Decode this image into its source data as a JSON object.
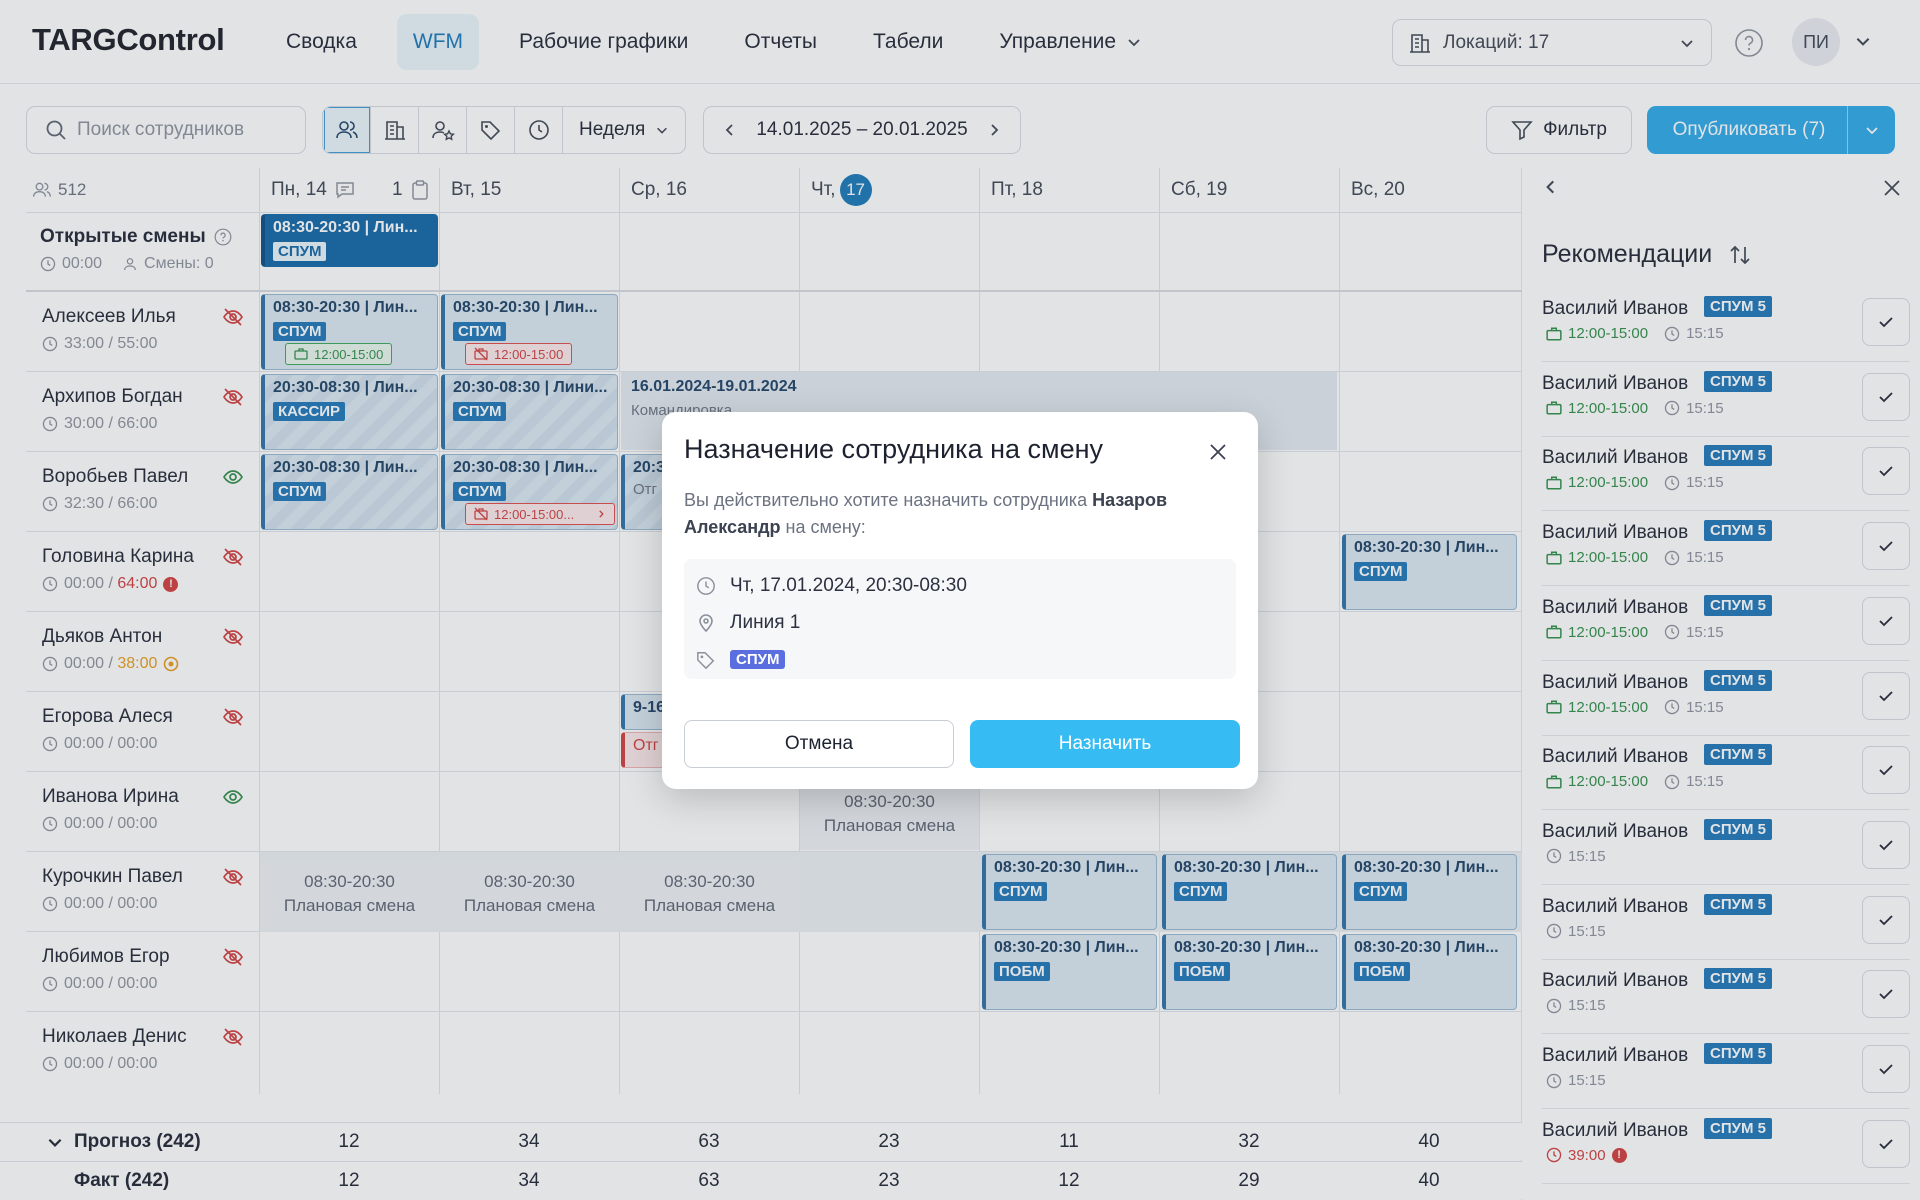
{
  "header": {
    "logo": "TARGControl",
    "nav": [
      {
        "label": "Сводка"
      },
      {
        "label": "WFM"
      },
      {
        "label": "Рабочие графики"
      },
      {
        "label": "Отчеты"
      },
      {
        "label": "Табели"
      },
      {
        "label": "Управление"
      }
    ],
    "locations": "Локаций: 17",
    "avatar": "ПИ"
  },
  "toolbar": {
    "search_placeholder": "Поиск сотрудников",
    "period": "Неделя",
    "date_range": "14.01.2025 – 20.01.2025",
    "filter": "Фильтр",
    "publish": "Опубликовать (7)"
  },
  "grid": {
    "count": "512",
    "days": [
      "Пн, 14",
      "Вт, 15",
      "Ср, 16",
      "Чт,",
      "Пт, 18",
      "Сб, 19",
      "Вс, 20"
    ],
    "today": "17",
    "mon_count": "1",
    "open": {
      "title": "Открытые смены",
      "hours": "00:00",
      "count": "Смены: 0"
    },
    "employees": [
      {
        "name": "Алексеев Илья",
        "hours": "33:00 / 55:00"
      },
      {
        "name": "Архипов Богдан",
        "hours": "30:00 / 66:00"
      },
      {
        "name": "Воробьев Павел",
        "hours": "32:30 / 66:00"
      },
      {
        "name": "Головина Карина",
        "hours_a": "00:00 / ",
        "hours_b": "64:00"
      },
      {
        "name": "Дьяков Антон",
        "hours_a": "00:00 / ",
        "hours_b": "38:00"
      },
      {
        "name": "Егорова Алеся",
        "hours": "00:00 / 00:00"
      },
      {
        "name": "Иванова Ирина",
        "hours": "00:00 / 00:00"
      },
      {
        "name": "Курочкин Павел",
        "hours": "00:00 / 00:00"
      },
      {
        "name": "Любимов Егор",
        "hours": "00:00 / 00:00"
      },
      {
        "name": "Николаев Денис",
        "hours": "00:00 / 00:00"
      }
    ],
    "shifts": {
      "day_lin": "08:30-20:30 | Лин...",
      "night_lin": "20:30-08:30 | Лин...",
      "night_lini": "20:30-08:30 | Лини...",
      "trip_dates": "16.01.2024-19.01.2024",
      "trip": "Командировка",
      "tag_spum": "СПУМ",
      "tag_kassir": "КАССИР",
      "tag_pobm": "ПОБМ",
      "slot_ok": "12:00-15:00",
      "slot_bad": "12:00-15:00",
      "slot_bad2": "12:00-15:00...",
      "partial_20": "20:3",
      "partial_ot": "Отг",
      "partial_916": "9-16",
      "plan_time": "08:30-20:30",
      "plan_label": "Плановая смена"
    },
    "forecast": {
      "label": "Прогноз (242)",
      "values": [
        "12",
        "34",
        "63",
        "23",
        "11",
        "32",
        "40"
      ]
    },
    "fact": {
      "label": "Факт (242)",
      "values": [
        "12",
        "34",
        "63",
        "23",
        "12",
        "29",
        "40"
      ]
    }
  },
  "modal": {
    "title": "Назначение сотрудника на смену",
    "desc_a": "Вы действительно хотите назначить сотрудника ",
    "desc_name": "Назаров Александр",
    "desc_b": " на смену:",
    "date": "Чт, 17.01.2024, 20:30-08:30",
    "line": "Линия 1",
    "tag": "СПУМ",
    "cancel": "Отмена",
    "confirm": "Назначить"
  },
  "panel": {
    "title": "Рекомендации",
    "items": [
      {
        "name": "Василий Иванов",
        "badge": "СПУМ 5",
        "slot": "12:00-15:00",
        "time": "15:15"
      },
      {
        "name": "Василий Иванов",
        "badge": "СПУМ 5",
        "slot": "12:00-15:00",
        "time": "15:15"
      },
      {
        "name": "Василий Иванов",
        "badge": "СПУМ 5",
        "slot": "12:00-15:00",
        "time": "15:15"
      },
      {
        "name": "Василий Иванов",
        "badge": "СПУМ 5",
        "slot": "12:00-15:00",
        "time": "15:15"
      },
      {
        "name": "Василий Иванов",
        "badge": "СПУМ 5",
        "slot": "12:00-15:00",
        "time": "15:15"
      },
      {
        "name": "Василий Иванов",
        "badge": "СПУМ 5",
        "slot": "12:00-15:00",
        "time": "15:15"
      },
      {
        "name": "Василий Иванов",
        "badge": "СПУМ 5",
        "slot": "12:00-15:00",
        "time": "15:15"
      },
      {
        "name": "Василий Иванов",
        "badge": "СПУМ 5",
        "time": "15:15"
      },
      {
        "name": "Василий Иванов",
        "badge": "СПУМ 5",
        "time": "15:15"
      },
      {
        "name": "Василий Иванов",
        "badge": "СПУМ 5",
        "time": "15:15"
      },
      {
        "name": "Василий Иванов",
        "badge": "СПУМ 5",
        "time": "15:15"
      },
      {
        "name": "Василий Иванов",
        "badge": "СПУМ 5",
        "time": "39:00"
      }
    ]
  }
}
